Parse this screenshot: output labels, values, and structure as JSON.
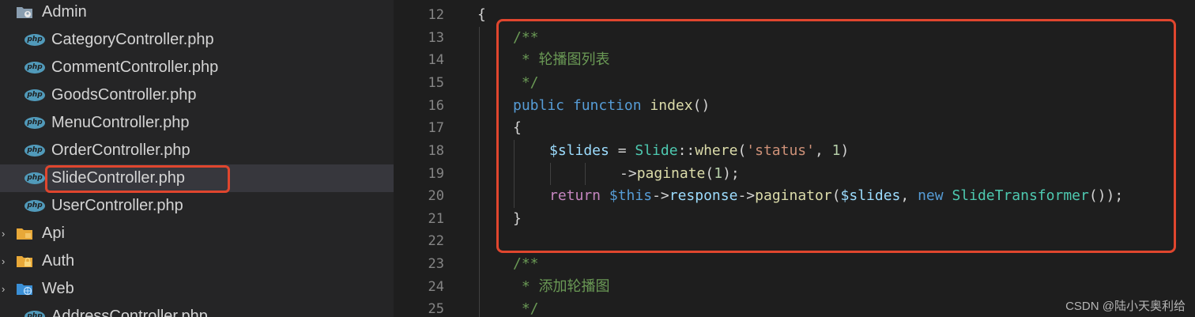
{
  "explorer": {
    "folders": {
      "admin": "Admin",
      "api": "Api",
      "auth": "Auth",
      "web": "Web"
    },
    "php_badge": "php",
    "admin_files": [
      "CategoryController.php",
      "CommentController.php",
      "GoodsController.php",
      "MenuController.php",
      "OrderController.php",
      "SlideController.php",
      "UserController.php"
    ],
    "web_files": [
      "AddressController.php"
    ],
    "selected_file": "SlideController.php"
  },
  "editor": {
    "line_numbers": [
      "12",
      "13",
      "14",
      "15",
      "16",
      "17",
      "18",
      "19",
      "20",
      "21",
      "22",
      "23",
      "24",
      "25"
    ],
    "code": {
      "l12": {
        "brace": "{"
      },
      "l13": {
        "comment": "/**"
      },
      "l14": {
        "comment": " * 轮播图列表"
      },
      "l15": {
        "comment": " */"
      },
      "l16": {
        "kw_public": "public",
        "kw_function": "function",
        "fn": "index",
        "parens": "()"
      },
      "l17": {
        "brace": "{"
      },
      "l18": {
        "var": "$slides",
        "eq": " = ",
        "type": "Slide",
        "sep": "::",
        "fn": "where",
        "open": "(",
        "str": "'status'",
        "comma": ", ",
        "num": "1",
        "close": ")"
      },
      "l19": {
        "arrow": "->",
        "fn": "paginate",
        "open": "(",
        "num": "1",
        "close": ");"
      },
      "l20": {
        "kw_return": "return",
        "var_this": "$this",
        "arrow1": "->",
        "prop": "response",
        "arrow2": "->",
        "fn": "paginator",
        "open": "(",
        "var": "$slides",
        "comma": ", ",
        "kw_new": "new",
        "type": "SlideTransformer",
        "close": "());"
      },
      "l21": {
        "brace": "}"
      },
      "l23": {
        "comment": "/**"
      },
      "l24": {
        "comment": " * 添加轮播图"
      },
      "l25": {
        "comment": " */"
      }
    }
  },
  "watermark": "CSDN @陆小天奥利给",
  "colors": {
    "highlight_box": "#e0462e",
    "comment": "#6a9955",
    "keyword": "#569cd6",
    "function": "#dcdcaa",
    "variable": "#9cdcfe",
    "type": "#4ec9b0",
    "string": "#ce9178",
    "number": "#b5cea8",
    "control": "#c586c0"
  },
  "icons": {
    "admin_folder": "admin-folder-icon",
    "api_folder": "api-folder-icon",
    "auth_folder": "lock-folder-icon",
    "web_folder": "globe-folder-icon",
    "php_file": "php-file-icon",
    "chevron": "chevron-right-icon"
  }
}
